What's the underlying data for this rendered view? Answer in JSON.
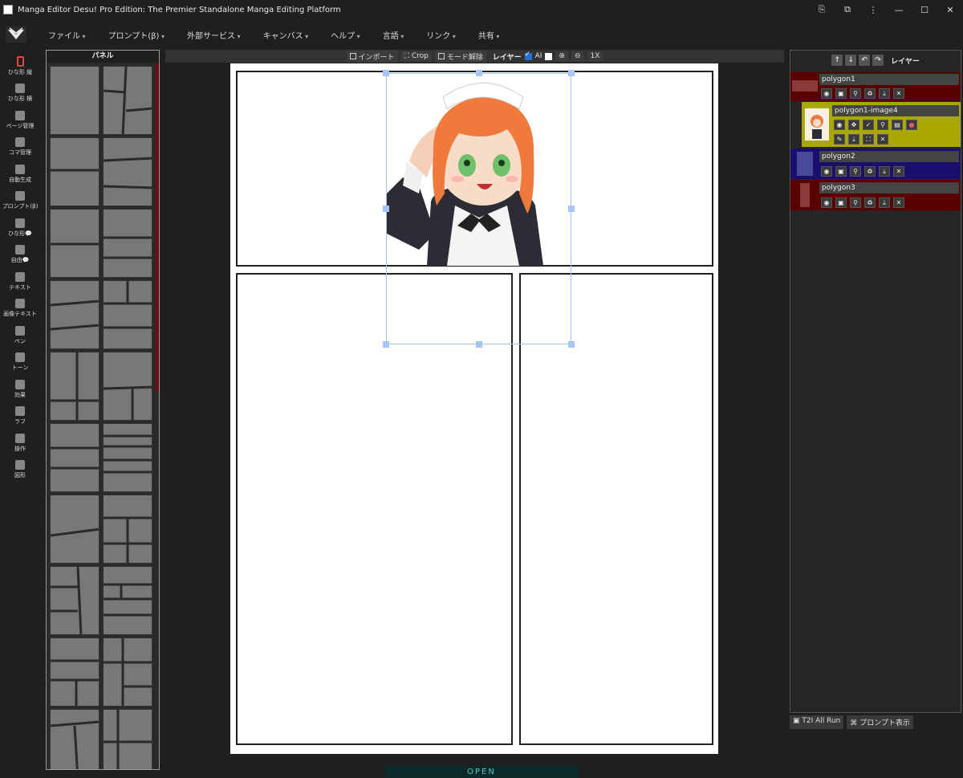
{
  "window": {
    "title": "Manga Editor Desu! Pro Edition: The Premier Standalone Manga Editing Platform"
  },
  "menu": [
    "ファイル",
    "プロンプト(β)",
    "外部サービス",
    "キャンバス",
    "ヘルプ",
    "言語",
    "リンク",
    "共有"
  ],
  "tools": [
    {
      "label": "ひな形 縦",
      "icon": "vertical-template-icon"
    },
    {
      "label": "ひな形 横",
      "icon": "horizontal-template-icon"
    },
    {
      "label": "ページ管理",
      "icon": "page-manage-icon"
    },
    {
      "label": "コマ管理",
      "icon": "panel-manage-icon"
    },
    {
      "label": "自動生成",
      "icon": "robot-icon"
    },
    {
      "label": "プロンプト(β)",
      "icon": "prompt-icon"
    },
    {
      "label": "ひな形💬",
      "icon": "bubble-template-icon"
    },
    {
      "label": "自由💬",
      "icon": "free-bubble-icon"
    },
    {
      "label": "テキスト",
      "icon": "text-icon"
    },
    {
      "label": "画像テキスト",
      "icon": "image-text-icon"
    },
    {
      "label": "ペン",
      "icon": "pen-icon"
    },
    {
      "label": "トーン",
      "icon": "tone-icon"
    },
    {
      "label": "効果",
      "icon": "effect-icon"
    },
    {
      "label": "ラフ",
      "icon": "rough-icon"
    },
    {
      "label": "操作",
      "icon": "gamepad-icon"
    },
    {
      "label": "図形",
      "icon": "shapes-icon"
    }
  ],
  "panel_library": {
    "title": "パネル"
  },
  "toolbar": {
    "import": "インポート",
    "crop": "Crop",
    "mode_release": "モード解除",
    "layer_label": "レイヤー",
    "ai_label": "AI",
    "zoom_reset": "1X"
  },
  "layers": {
    "title": "レイヤー",
    "items": [
      {
        "name": "polygon1"
      },
      {
        "name": "polygon1-image4"
      },
      {
        "name": "polygon2"
      },
      {
        "name": "polygon3"
      }
    ]
  },
  "bottom": {
    "t2i_all_run": "T2I All Run",
    "prompt_show": "プロンプト表示"
  },
  "status": {
    "open": "OPEN"
  },
  "colors": {
    "accent_red": "#e04646",
    "layer1_bg": "#5a0000",
    "layer_image_bg": "#a8a800",
    "layer2_bg": "#1a0e6e",
    "layer3_bg": "#5a0000",
    "open_text": "#3dd1c8",
    "selection": "#a8c6f5"
  }
}
